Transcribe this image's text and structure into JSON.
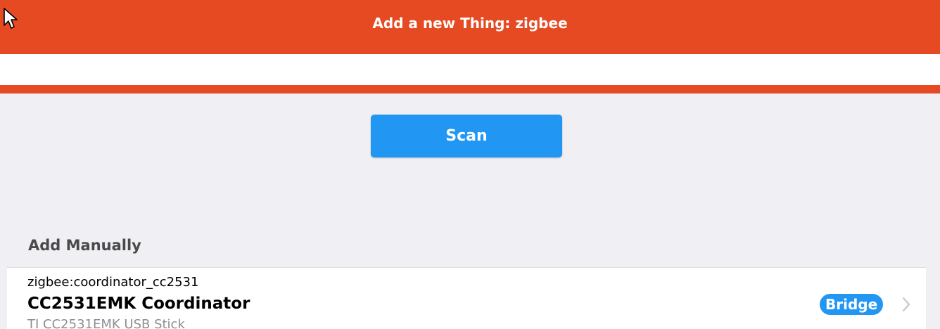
{
  "navbar": {
    "title": "Add a new Thing: zigbee",
    "color": "#e64a22"
  },
  "scan": {
    "label": "Scan",
    "color": "#2196f3"
  },
  "manual": {
    "section_title": "Add Manually",
    "items": [
      {
        "uid": "zigbee:coordinator_cc2531",
        "label": "CC2531EMK Coordinator",
        "description": "TI CC2531EMK USB Stick",
        "badge": "Bridge",
        "icon": "chevron-right-icon"
      }
    ]
  },
  "icons": {
    "cursor": "mouse-pointer-icon"
  }
}
